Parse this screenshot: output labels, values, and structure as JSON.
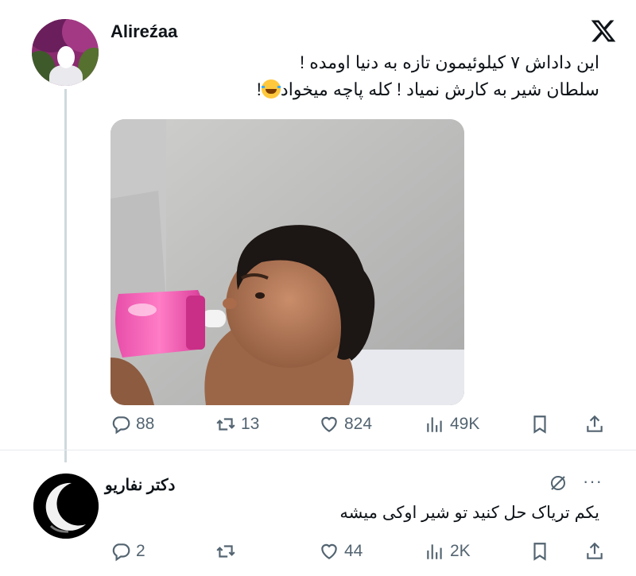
{
  "post": {
    "author": "Alireźaa",
    "text_line1": "این داداش ۷ کیلوئیمون تازه به دنیا اومده !",
    "text_line2": "سلطان شیر به کارش نمیاد ! کله پاچه میخواد",
    "text_line2_end": "!",
    "emoji": "face-with-tears-of-joy-emoji",
    "replies": "88",
    "reposts": "13",
    "likes": "824",
    "views": "49K"
  },
  "reply": {
    "author": "دکتر نفاریو",
    "text": "یکم تریاک حل کنید تو شیر اوکی میشه",
    "replies": "2",
    "reposts": "",
    "likes": "44",
    "views": "2K",
    "more": "···"
  },
  "icons": {
    "brand": "x-logo-icon",
    "reply": "reply-icon",
    "repost": "repost-icon",
    "like": "heart-icon",
    "views": "views-icon",
    "bookmark": "bookmark-icon",
    "share": "share-icon",
    "grok": "grok-icon"
  },
  "colors": {
    "text": "#0f1419",
    "muted": "#536471",
    "thread_line": "#cfd9de"
  }
}
